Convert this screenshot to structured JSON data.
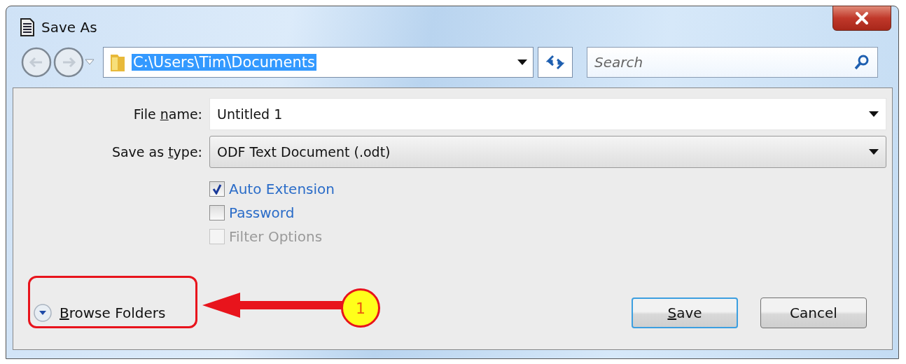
{
  "window": {
    "title": "Save As"
  },
  "address_bar": {
    "path": "C:\\Users\\Tim\\Documents",
    "selected": true
  },
  "search": {
    "placeholder": "Search"
  },
  "fields": [
    {
      "kind": "text",
      "label": [
        {
          "text": "File ",
          "underlined": false
        },
        {
          "text": "n",
          "underlined": true
        },
        {
          "text": "ame:",
          "underlined": false
        }
      ],
      "value": "Untitled 1"
    },
    {
      "kind": "combo",
      "label": [
        {
          "text": "Save as ",
          "underlined": false
        },
        {
          "text": "t",
          "underlined": true
        },
        {
          "text": "ype:",
          "underlined": false
        }
      ],
      "value": "ODF Text Document (.odt)"
    }
  ],
  "options": [
    {
      "label": "Auto Extension",
      "checked": true,
      "disabled": false
    },
    {
      "label": "Password",
      "checked": false,
      "disabled": false
    },
    {
      "label": "Filter Options",
      "checked": false,
      "disabled": true
    }
  ],
  "browse_folders": {
    "label": [
      {
        "text": "B",
        "underlined": true
      },
      {
        "text": "rowse Folders",
        "underlined": false
      }
    ]
  },
  "buttons": [
    {
      "label": [
        {
          "text": "S",
          "underlined": true
        },
        {
          "text": "ave",
          "underlined": false
        }
      ],
      "selected": true
    },
    {
      "label": [
        {
          "text": "Cancel",
          "underlined": false
        }
      ],
      "selected": false
    }
  ],
  "annotation": {
    "number": "1"
  }
}
